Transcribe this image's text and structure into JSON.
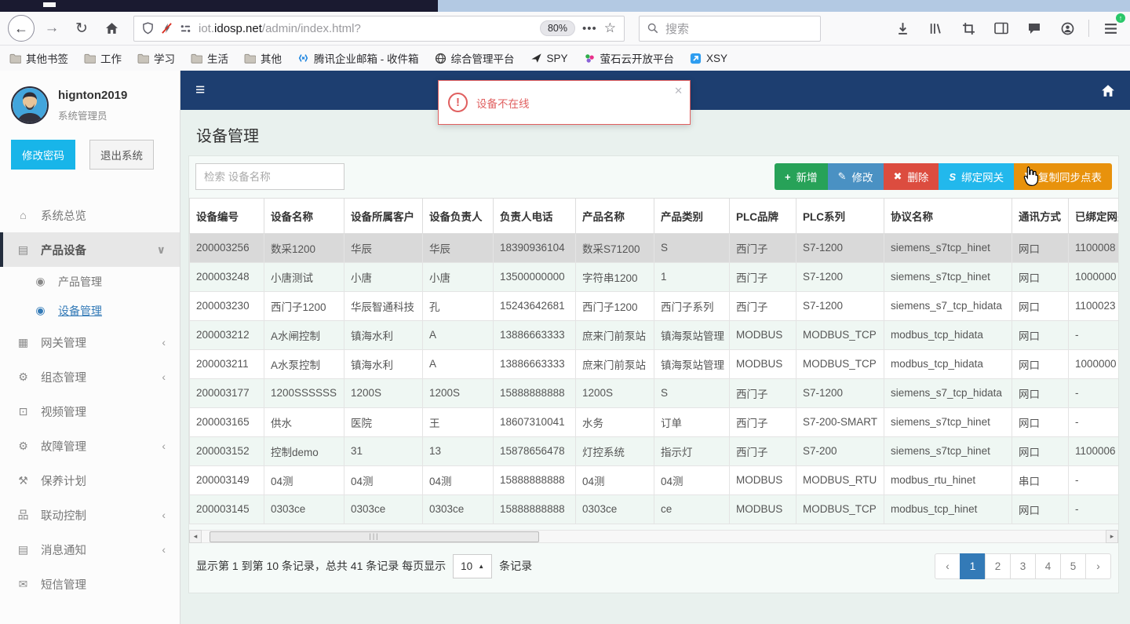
{
  "browser": {
    "url_prefix": "iot.",
    "url_host": "idosp.net",
    "url_path": "/admin/index.html?",
    "zoom_badge": "80%",
    "search_placeholder": "搜索",
    "bookmarks": [
      {
        "label": "其他书签",
        "icon": "folder-icon"
      },
      {
        "label": "工作",
        "icon": "folder-icon"
      },
      {
        "label": "学习",
        "icon": "folder-icon"
      },
      {
        "label": "生活",
        "icon": "folder-icon"
      },
      {
        "label": "其他",
        "icon": "folder-icon"
      },
      {
        "label": "腾讯企业邮箱 - 收件箱",
        "icon": "tencent-mail-icon"
      },
      {
        "label": "综合管理平台",
        "icon": "globe-icon"
      },
      {
        "label": "SPY",
        "icon": "plane-icon"
      },
      {
        "label": "萤石云开放平台",
        "icon": "ezviz-icon"
      },
      {
        "label": "XSY",
        "icon": "xsy-icon"
      }
    ]
  },
  "sidebar": {
    "user": {
      "name": "hignton2019",
      "role": "系统管理员"
    },
    "change_password": "修改密码",
    "logout": "退出系统",
    "menu": [
      {
        "label": "系统总览",
        "icon": "home-icon",
        "chevron": ""
      },
      {
        "label": "产品设备",
        "icon": "book-icon",
        "chevron": "down",
        "active": true
      },
      {
        "label": "产品管理",
        "icon": "dot-circle-icon",
        "sub": true
      },
      {
        "label": "设备管理",
        "icon": "dot-circle-icon",
        "sub": true,
        "selected": true
      },
      {
        "label": "网关管理",
        "icon": "gateway-icon",
        "chevron": "left"
      },
      {
        "label": "组态管理",
        "icon": "gears-icon",
        "chevron": "left"
      },
      {
        "label": "视频管理",
        "icon": "monitor-icon",
        "chevron": ""
      },
      {
        "label": "故障管理",
        "icon": "gears-icon",
        "chevron": "left"
      },
      {
        "label": "保养计划",
        "icon": "wrench-icon",
        "chevron": ""
      },
      {
        "label": "联动控制",
        "icon": "sitemap-icon",
        "chevron": "left"
      },
      {
        "label": "消息通知",
        "icon": "notebook-icon",
        "chevron": "left"
      },
      {
        "label": "短信管理",
        "icon": "envelope-icon",
        "chevron": ""
      }
    ]
  },
  "topbar": {
    "burger": "≡"
  },
  "alert": {
    "message": "设备不在线",
    "close": "✕"
  },
  "page": {
    "title": "设备管理"
  },
  "toolbar": {
    "search_placeholder": "检索 设备名称",
    "buttons": [
      {
        "label": "新增",
        "icon": "plus-icon",
        "color": "#27a258"
      },
      {
        "label": "修改",
        "icon": "pencil-icon",
        "color": "#4a91c3"
      },
      {
        "label": "删除",
        "icon": "x-icon",
        "color": "#dc4c3f"
      },
      {
        "label": "绑定网关",
        "icon": "link-icon",
        "color": "#22b8ec"
      },
      {
        "label": "复制同步点表",
        "icon": "refresh-icon",
        "color": "#e8920c"
      }
    ]
  },
  "table": {
    "headers": [
      "设备编号",
      "设备名称",
      "设备所属客户",
      "设备负责人",
      "负责人电话",
      "产品名称",
      "产品类别",
      "PLC品牌",
      "PLC系列",
      "协议名称",
      "通讯方式",
      "已绑定网关"
    ],
    "rows": [
      [
        "200003256",
        "数采1200",
        "华辰",
        "华辰",
        "18390936104",
        "数采S71200",
        "S",
        "西门子",
        "S7-1200",
        "siemens_s7tcp_hinet",
        "网口",
        "1100008"
      ],
      [
        "200003248",
        "小唐测试",
        "小唐",
        "小唐",
        "13500000000",
        "字符串1200",
        "1",
        "西门子",
        "S7-1200",
        "siemens_s7tcp_hinet",
        "网口",
        "1000000"
      ],
      [
        "200003230",
        "西门子1200",
        "华辰智通科技",
        "孔",
        "15243642681",
        "西门子1200",
        "西门子系列",
        "西门子",
        "S7-1200",
        "siemens_s7_tcp_hidata",
        "网口",
        "1100023"
      ],
      [
        "200003212",
        "A水闸控制",
        "镇海水利",
        "A",
        "13886663333",
        "庶来门前泵站",
        "镇海泵站管理",
        "MODBUS",
        "MODBUS_TCP",
        "modbus_tcp_hidata",
        "网口",
        "-"
      ],
      [
        "200003211",
        "A水泵控制",
        "镇海水利",
        "A",
        "13886663333",
        "庶来门前泵站",
        "镇海泵站管理",
        "MODBUS",
        "MODBUS_TCP",
        "modbus_tcp_hidata",
        "网口",
        "1000000"
      ],
      [
        "200003177",
        "1200SSSSSS",
        "1200S",
        "1200S",
        "15888888888",
        "1200S",
        "S",
        "西门子",
        "S7-1200",
        "siemens_s7_tcp_hidata",
        "网口",
        "-"
      ],
      [
        "200003165",
        "供水",
        "医院",
        "王",
        "18607310041",
        "水务",
        "订单",
        "西门子",
        "S7-200-SMART",
        "siemens_s7tcp_hinet",
        "网口",
        "-"
      ],
      [
        "200003152",
        "控制demo",
        "31",
        "13",
        "15878656478",
        "灯控系统",
        "指示灯",
        "西门子",
        "S7-200",
        "siemens_s7tcp_hinet",
        "网口",
        "1100006"
      ],
      [
        "200003149",
        "04测",
        "04测",
        "04测",
        "15888888888",
        "04测",
        "04测",
        "MODBUS",
        "MODBUS_RTU",
        "modbus_rtu_hinet",
        "串口",
        "-"
      ],
      [
        "200003145",
        "0303ce",
        "0303ce",
        "0303ce",
        "15888888888",
        "0303ce",
        "ce",
        "MODBUS",
        "MODBUS_TCP",
        "modbus_tcp_hinet",
        "网口",
        "-"
      ]
    ]
  },
  "footer": {
    "info_before": "显示第 1 到第 10 条记录，总共 41 条记录 每页显示",
    "page_size": "10",
    "info_after": "条记录",
    "pagination": {
      "prev": "‹",
      "next": "›",
      "pages": [
        "1",
        "2",
        "3",
        "4",
        "5"
      ],
      "active_page": "1"
    }
  },
  "icons": {
    "home-icon": "⌂",
    "book-icon": "▤",
    "dot-circle-icon": "◉",
    "gateway-icon": "▦",
    "gears-icon": "⚙",
    "monitor-icon": "⊡",
    "wrench-icon": "⚒",
    "sitemap-icon": "品",
    "notebook-icon": "▤",
    "envelope-icon": "✉",
    "plus-icon": "+",
    "pencil-icon": "✎",
    "x-icon": "✖",
    "link-icon": "S",
    "refresh-icon": "↻",
    "chevron-down": "∨",
    "chevron-left": "‹",
    "back-icon": "←",
    "forward-icon": "→",
    "reload-icon": "↻",
    "scroll-left": "◂",
    "scroll-right": "▸",
    "size-caret": "▲"
  },
  "colors": {
    "navbar": "#1d3e70",
    "content_bg": "#e9f1ee",
    "selected_row": "#d9d9d9",
    "stripe_row": "#eff7f3",
    "active_page": "#337ab7",
    "alert_red": "#e05f5f"
  }
}
